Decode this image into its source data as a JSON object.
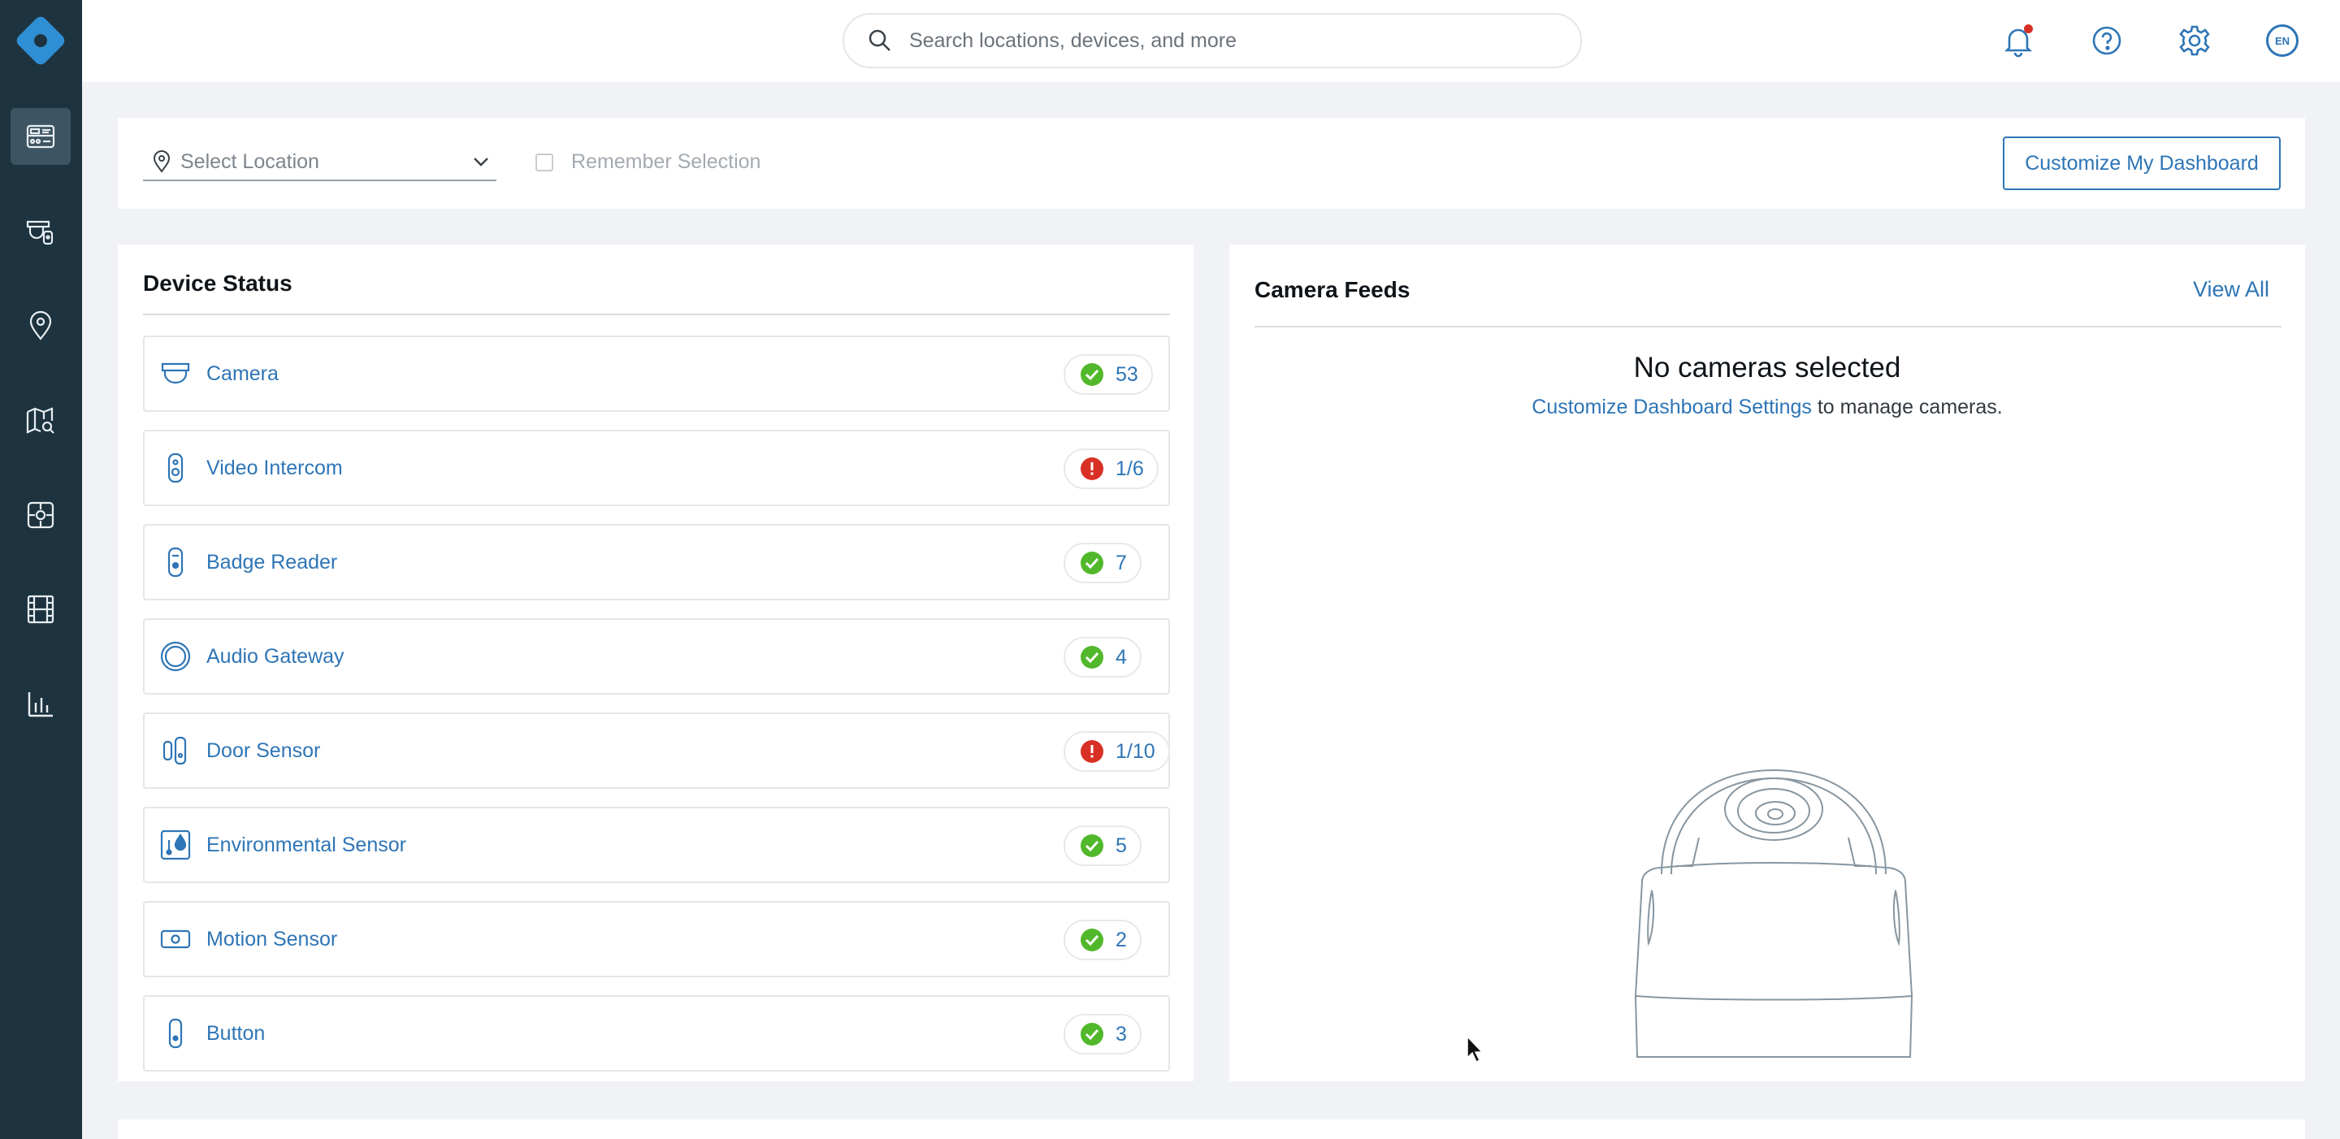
{
  "sidebar": {
    "logo": "logo-icon",
    "items": [
      {
        "icon": "dashboard-icon",
        "active": true
      },
      {
        "icon": "devices-icon",
        "active": false
      },
      {
        "icon": "location-pin-icon",
        "active": false
      },
      {
        "icon": "map-search-icon",
        "active": false
      },
      {
        "icon": "floor-plan-icon",
        "active": false
      },
      {
        "icon": "film-icon",
        "active": false
      },
      {
        "icon": "analytics-icon",
        "active": false
      }
    ]
  },
  "topbar": {
    "search_placeholder": "Search locations, devices, and more",
    "language": "EN",
    "has_notification": true
  },
  "filter": {
    "location_placeholder": "Select Location",
    "remember_label": "Remember Selection",
    "remember_checked": false,
    "customize_label": "Customize My Dashboard"
  },
  "device_status": {
    "title": "Device Status",
    "rows": [
      {
        "name": "Camera",
        "icon": "camera-icon",
        "status": "ok",
        "count": "53"
      },
      {
        "name": "Video Intercom",
        "icon": "intercom-icon",
        "status": "error",
        "count": "1/6"
      },
      {
        "name": "Badge Reader",
        "icon": "badge-reader-icon",
        "status": "ok",
        "count": "7"
      },
      {
        "name": "Audio Gateway",
        "icon": "audio-gateway-icon",
        "status": "ok",
        "count": "4"
      },
      {
        "name": "Door Sensor",
        "icon": "door-sensor-icon",
        "status": "error",
        "count": "1/10"
      },
      {
        "name": "Environmental Sensor",
        "icon": "environmental-sensor-icon",
        "status": "ok",
        "count": "5"
      },
      {
        "name": "Motion Sensor",
        "icon": "motion-sensor-icon",
        "status": "ok",
        "count": "2"
      },
      {
        "name": "Button",
        "icon": "button-device-icon",
        "status": "ok",
        "count": "3"
      }
    ]
  },
  "camera_feeds": {
    "title": "Camera Feeds",
    "view_all": "View All",
    "empty_title": "No cameras selected",
    "empty_link": "Customize Dashboard Settings",
    "empty_suffix": " to manage cameras."
  },
  "colors": {
    "sidebar_bg": "#1d3440",
    "accent": "#2e75b6",
    "ok": "#52b82b",
    "error": "#d93025"
  }
}
